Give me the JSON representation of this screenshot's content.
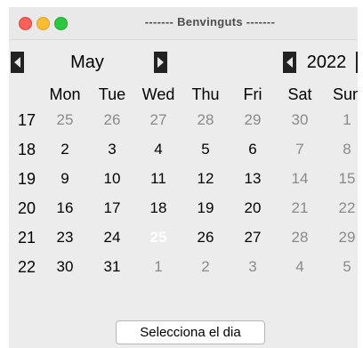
{
  "window": {
    "title": "------- Benvinguts -------"
  },
  "calendar": {
    "month": "May",
    "year": "2022",
    "weekdays": [
      "Mon",
      "Tue",
      "Wed",
      "Thu",
      "Fri",
      "Sat",
      "Sun"
    ],
    "weeks": [
      {
        "week": "17",
        "days": [
          "25",
          "26",
          "27",
          "28",
          "29",
          "30",
          "1"
        ]
      },
      {
        "week": "18",
        "days": [
          "2",
          "3",
          "4",
          "5",
          "6",
          "7",
          "8"
        ]
      },
      {
        "week": "19",
        "days": [
          "9",
          "10",
          "11",
          "12",
          "13",
          "14",
          "15"
        ]
      },
      {
        "week": "20",
        "days": [
          "16",
          "17",
          "18",
          "19",
          "20",
          "21",
          "22"
        ]
      },
      {
        "week": "21",
        "days": [
          "23",
          "24",
          "25",
          "26",
          "27",
          "28",
          "29"
        ]
      },
      {
        "week": "22",
        "days": [
          "30",
          "31",
          "1",
          "2",
          "3",
          "4",
          "5"
        ]
      }
    ],
    "selected_day": "25"
  },
  "footer": {
    "button_label": "Selecciona el dia"
  }
}
